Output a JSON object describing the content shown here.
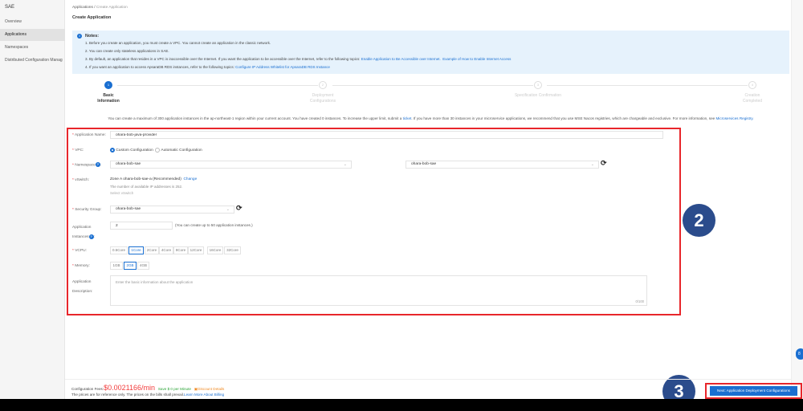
{
  "sidebar": {
    "title": "SAE",
    "items": [
      {
        "label": "Overview"
      },
      {
        "label": "Applications",
        "active": true
      },
      {
        "label": "Namespaces"
      },
      {
        "label": "Distributed Configuration Manag"
      }
    ]
  },
  "breadcrumb": {
    "root": "Applications",
    "sep": "/",
    "current": "Create Application"
  },
  "page_title": "Create Application",
  "notes": {
    "title": "Notes:",
    "lines": [
      "1. Before you create an application, you must create a VPC. You cannot create an application in the classic network.",
      "2. You can create only stateless applications in SAE.",
      "3. By default, an application that resides in a VPC is inaccessible over the Internet. If you want the application to be accessible over the Internet, refer to the following topics:",
      "4. If you want an application to access ApsaraDB RDS instances, refer to the following topics:"
    ],
    "link1": "Enable Application to Be Accessible over Internet.",
    "link2": "Example of How to Enable Internet Access",
    "link3": "Configure IP Address Whitelist for ApsaraDB RDS Instance"
  },
  "steps": [
    {
      "num": "1",
      "label": "Basic Information"
    },
    {
      "num": "2",
      "label": "Deployment Configurations"
    },
    {
      "num": "3",
      "label": "Specification Confirmation"
    },
    {
      "num": "4",
      "label": "Creation Completed"
    }
  ],
  "info": {
    "text": "You can create a maximum of 300 application instances in the ap-northeast-1 region within your current account. You have created 0 instances. To increase the upper limit, submit a",
    "ticket": "ticket",
    "text2": ". If you have more than 30 instances in your microservice applications, we recommend that you use MSE Nacos registries, which are chargeable and exclusive. For more information, see",
    "link": "Microservices Registry."
  },
  "form": {
    "app_name_label": "Application Name:",
    "app_name": "ohara-bob-java-provider",
    "vpc_label": "VPC:",
    "vpc_custom": "Custom Configuration",
    "vpc_auto": "Automatic Configuration",
    "namespace_label": "Namespace",
    "namespace": "ohara-bob-sae",
    "vpc_select": "ohara-bob-sae",
    "vswitch_label": "vSwitch:",
    "vswitch_value": "Zone A ohara-bob-sae-a (Recommended)",
    "vswitch_change": "Change",
    "vswitch_ips": "The number of available IP addresses is 252.",
    "vswitch_select": "Select vSwitch",
    "sg_label": "Security Group:",
    "sg": "ohara-bob-sae",
    "instances_label1": "Application",
    "instances_label2": "Instances",
    "instances": "2",
    "instances_hint": "(You can create up to 50 application instances.)",
    "vcpu_label": "VCPU:",
    "vcpu_options": [
      "0.5Core",
      "1Core",
      "2Core",
      "4Core",
      "8Core",
      "12Core",
      "16Core",
      "32Core"
    ],
    "vcpu_selected": "1Core",
    "memory_label": "Memory:",
    "memory_options": [
      "1GB",
      "2GB",
      "4GB"
    ],
    "memory_selected": "2GB",
    "desc_label1": "Application",
    "desc_label2": "Description:",
    "desc_placeholder": "Enter the basic information about the application",
    "desc_count": "0/100"
  },
  "footer": {
    "fees_label": "Configuration Fees:",
    "fees": "$0.0021166/min",
    "save": "Save $ 0 per Minute",
    "discount": "Discount Details",
    "note": "The prices are for reference only. The prices on the bills shall prevail.",
    "billing_link": "Learn More About Billing",
    "next": "Next: Application Deployment Configurations"
  },
  "annotations": {
    "a2": "2",
    "a3": "3"
  },
  "float_badge": "8"
}
